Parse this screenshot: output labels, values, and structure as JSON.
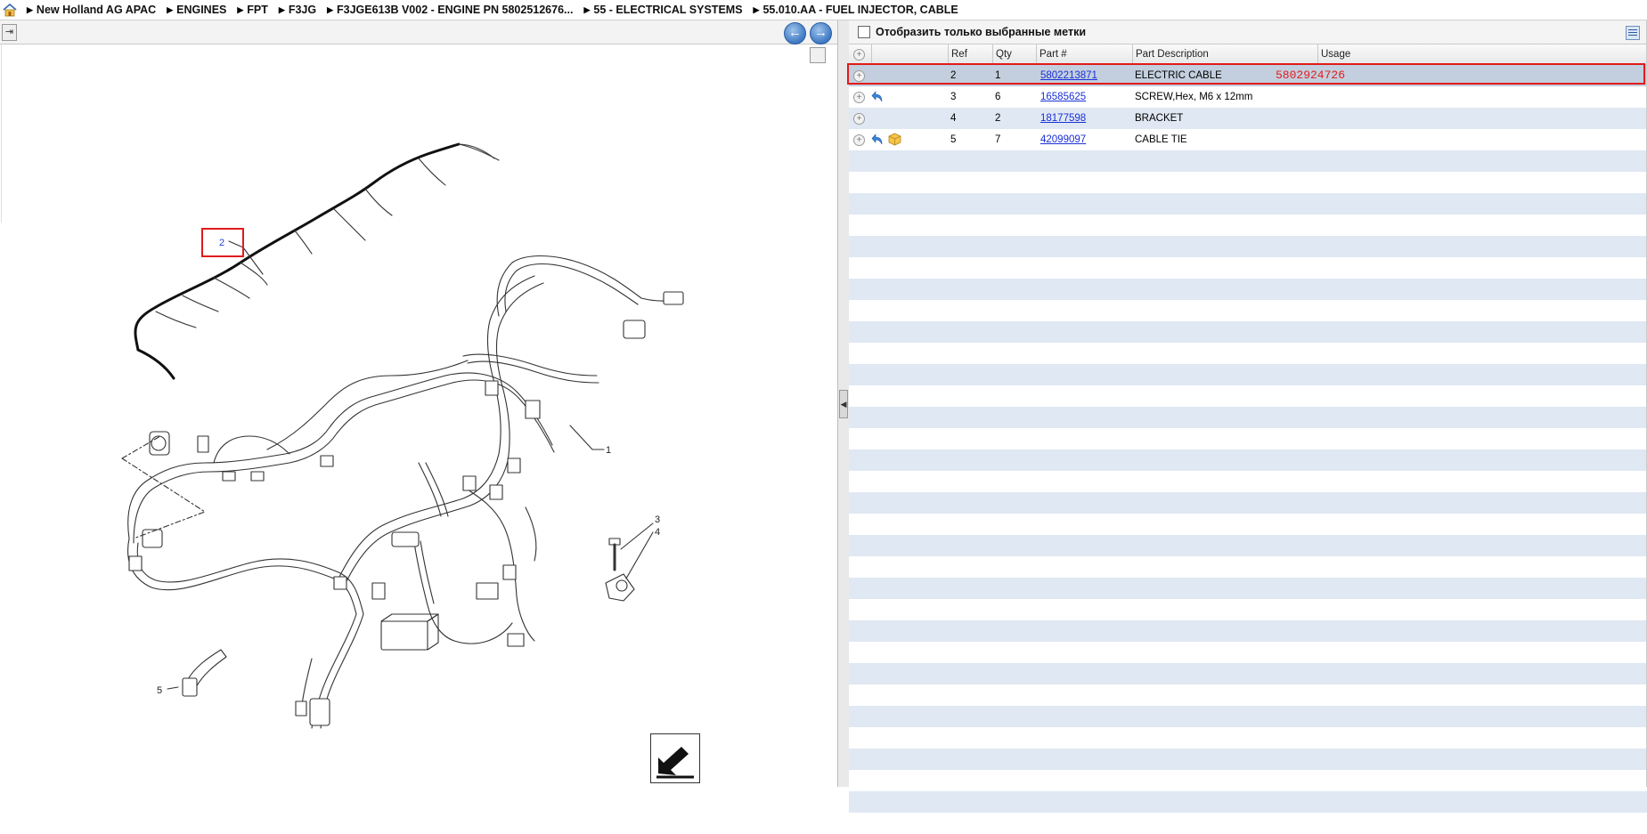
{
  "breadcrumb": {
    "items": [
      "New Holland AG APAC",
      "ENGINES",
      "FPT",
      "F3JG",
      "F3JGE613B V002 - ENGINE PN 5802512676...",
      "55 - ELECTRICAL SYSTEMS",
      "55.010.AA - FUEL INJECTOR, CABLE"
    ]
  },
  "filter": {
    "label": "Отобразить только выбранные метки",
    "checked": false
  },
  "grid": {
    "headers": [
      "Ref",
      "Qty",
      "Part #",
      "Part Description",
      "Usage"
    ],
    "rows": [
      {
        "ref": "2",
        "qty": "1",
        "part": "5802213871",
        "description": "ELECTRIC CABLE",
        "usage": "",
        "icons": []
      },
      {
        "ref": "3",
        "qty": "6",
        "part": "16585625",
        "description": "SCREW,Hex, M6 x 12mm",
        "usage": "",
        "icons": [
          "back-arrow-icon"
        ]
      },
      {
        "ref": "4",
        "qty": "2",
        "part": "18177598",
        "description": "BRACKET",
        "usage": "",
        "icons": []
      },
      {
        "ref": "5",
        "qty": "7",
        "part": "42099097",
        "description": "CABLE TIE",
        "usage": "",
        "icons": [
          "back-arrow-icon",
          "package-icon"
        ]
      }
    ]
  },
  "annotation": {
    "note": "5802924726",
    "color": "#e31b1b"
  },
  "diagram": {
    "callouts": [
      "1",
      "2",
      "3",
      "4",
      "5"
    ]
  },
  "colors": {
    "row_stripe": "#dfe8f3",
    "selected": "#c3cfde",
    "link": "#1a2fd8",
    "highlight": "#e01b1b"
  }
}
